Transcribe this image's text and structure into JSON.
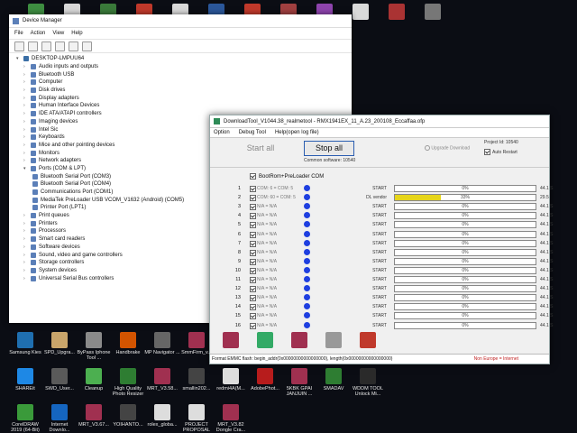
{
  "desktop_top_icons": [
    {
      "name": "icon-1",
      "color": "#3e8e41"
    },
    {
      "name": "icon-2",
      "color": "#d8d8d8"
    },
    {
      "name": "icon-3",
      "color": "#3a7a3a"
    },
    {
      "name": "icon-4",
      "color": "#c0392b"
    },
    {
      "name": "icon-5",
      "color": "#d9d9d9"
    },
    {
      "name": "icon-6",
      "color": "#2b579a"
    },
    {
      "name": "icon-7",
      "color": "#c0392b"
    },
    {
      "name": "icon-8",
      "color": "#a04040"
    },
    {
      "name": "icon-9",
      "color": "#8e44ad"
    },
    {
      "name": "icon-10",
      "color": "#d9d9d9"
    },
    {
      "name": "icon-11",
      "color": "#a33"
    },
    {
      "name": "icon-12",
      "color": "#777"
    }
  ],
  "desktop_bottom_icons": [
    {
      "label": "Samsung Kies",
      "color": "#1f6fb0"
    },
    {
      "label": "SPD_Upgra...",
      "color": "#c9a56b"
    },
    {
      "label": "ByPass Iphone Tool ...",
      "color": "#8a8a8a"
    },
    {
      "label": "Handbrake",
      "color": "#d35400"
    },
    {
      "label": "MP Navigator ...",
      "color": "#666"
    },
    {
      "label": "SmmFirm_v...",
      "color": "#a03050"
    },
    {
      "label": "",
      "color": "#a03050"
    },
    {
      "label": "",
      "color": "#3a6"
    },
    {
      "label": "",
      "color": "#a03050"
    },
    {
      "label": "",
      "color": "#999"
    },
    {
      "label": "Resetter-Ep...",
      "color": "#c0392b"
    },
    {
      "label": "SHAREit",
      "color": "#1e88e5"
    },
    {
      "label": "SWD_User...",
      "color": "#5a5a5a"
    },
    {
      "label": "Cleanup",
      "color": "#4caf50"
    },
    {
      "label": "High Quality Photo Resizer",
      "color": "#2e7d32"
    },
    {
      "label": "MRT_V3.58...",
      "color": "#a03050"
    },
    {
      "label": "smallin202...",
      "color": "#444"
    },
    {
      "label": "redmi4A(M...",
      "color": "#ddd"
    },
    {
      "label": "AdobePhot...",
      "color": "#b71c1c"
    },
    {
      "label": "5KBK GPAI JANJUIN ...",
      "color": "#a03050"
    },
    {
      "label": "SMADAV",
      "color": "#2e7d32"
    },
    {
      "label": "WDDM TOOL Unlock Mi...",
      "color": "#2a2a2a"
    },
    {
      "label": "CorelDRAW 2019 (64-Bit)",
      "color": "#3a9a3a"
    },
    {
      "label": "Internet Downlo...",
      "color": "#1565c0"
    },
    {
      "label": "MRT_V3.67...",
      "color": "#a03050"
    },
    {
      "label": "YOIHANTO...",
      "color": "#444"
    },
    {
      "label": "rolex_globa...",
      "color": "#ddd"
    },
    {
      "label": "PROJECT PROPOSAL",
      "color": "#ddd"
    },
    {
      "label": "MRT_V3.82 Dongle Cra...",
      "color": "#a03050"
    }
  ],
  "device_manager": {
    "title": "Device Manager",
    "menu": [
      "File",
      "Action",
      "View",
      "Help"
    ],
    "root": "DESKTOP-LMPUU64",
    "categories": [
      "Audio inputs and outputs",
      "Bluetooth USB",
      "Computer",
      "Disk drives",
      "Display adapters",
      "Human Interface Devices",
      "IDE ATA/ATAPI controllers",
      "Imaging devices",
      "Intel Sic",
      "Keyboards",
      "Mice and other pointing devices",
      "Monitors",
      "Network adapters",
      "Ports (COM & LPT)"
    ],
    "ports_children": [
      "Bluetooth Serial Port (COM3)",
      "Bluetooth Serial Port (COM4)",
      "Communications Port (COM1)",
      "MediaTek PreLoader USB VCOM_V1632 (Android) (COM5)",
      "Printer Port (LPT1)"
    ],
    "categories_after": [
      "Print queues",
      "Printers",
      "Processors",
      "Smart card readers",
      "Software devices",
      "Sound, video and game controllers",
      "Storage controllers",
      "System devices",
      "Universal Serial Bus controllers"
    ]
  },
  "download_tool": {
    "title": "DownloadTool_V1044.38_realmetool  -  RMX1941EX_11_A.23_200108_Eccaffaa.ofp",
    "menu": [
      "Option",
      "Debug Tool",
      "Help(open log file)"
    ],
    "start_all": "Start all",
    "stop_all": "Stop all",
    "common_software": "Common software: 10540",
    "upgrade_download": "Upgrade Download",
    "project_id": "Project Id: 10540",
    "auto_restart": "Auto Restart",
    "bootrom_label": "BootRom+PreLoader COM",
    "ports": [
      {
        "idx": "1",
        "com": "COM: 6 = COM: 5",
        "status": "START",
        "pct": "0%",
        "progress": 0,
        "speed": "44.1 S"
      },
      {
        "idx": "2",
        "com": "COM: 60 = COM: 5",
        "status": "DL vendor",
        "pct": "33%",
        "progress": 33,
        "speed": "29.5"
      },
      {
        "idx": "3",
        "com": "N/A = N/A",
        "status": "START",
        "pct": "0%",
        "progress": 0,
        "speed": "44.1 S"
      },
      {
        "idx": "4",
        "com": "N/A = N/A",
        "status": "START",
        "pct": "0%",
        "progress": 0,
        "speed": "44.1 S"
      },
      {
        "idx": "5",
        "com": "N/A = N/A",
        "status": "START",
        "pct": "0%",
        "progress": 0,
        "speed": "44.1 S"
      },
      {
        "idx": "6",
        "com": "N/A = N/A",
        "status": "START",
        "pct": "0%",
        "progress": 0,
        "speed": "44.1 S"
      },
      {
        "idx": "7",
        "com": "N/A = N/A",
        "status": "START",
        "pct": "0%",
        "progress": 0,
        "speed": "44.1 S"
      },
      {
        "idx": "8",
        "com": "N/A = N/A",
        "status": "START",
        "pct": "0%",
        "progress": 0,
        "speed": "44.1 S"
      },
      {
        "idx": "9",
        "com": "N/A = N/A",
        "status": "START",
        "pct": "0%",
        "progress": 0,
        "speed": "44.1 S"
      },
      {
        "idx": "10",
        "com": "N/A = N/A",
        "status": "START",
        "pct": "0%",
        "progress": 0,
        "speed": "44.1 S"
      },
      {
        "idx": "11",
        "com": "N/A = N/A",
        "status": "START",
        "pct": "0%",
        "progress": 0,
        "speed": "44.1 S"
      },
      {
        "idx": "12",
        "com": "N/A = N/A",
        "status": "START",
        "pct": "0%",
        "progress": 0,
        "speed": "44.1 S"
      },
      {
        "idx": "13",
        "com": "N/A = N/A",
        "status": "START",
        "pct": "0%",
        "progress": 0,
        "speed": "44.1 S"
      },
      {
        "idx": "14",
        "com": "N/A = N/A",
        "status": "START",
        "pct": "0%",
        "progress": 0,
        "speed": "44.1 S"
      },
      {
        "idx": "15",
        "com": "N/A = N/A",
        "status": "START",
        "pct": "0%",
        "progress": 0,
        "speed": "44.1 S"
      },
      {
        "idx": "16",
        "com": "N/A = N/A",
        "status": "START",
        "pct": "0%",
        "progress": 0,
        "speed": "44.1 S"
      }
    ],
    "statusbar_text": "Format EMMC flash: begin_addr(0x00000000000000000), length(0x00000000000000000)",
    "region": "Non Europe = Internet"
  }
}
